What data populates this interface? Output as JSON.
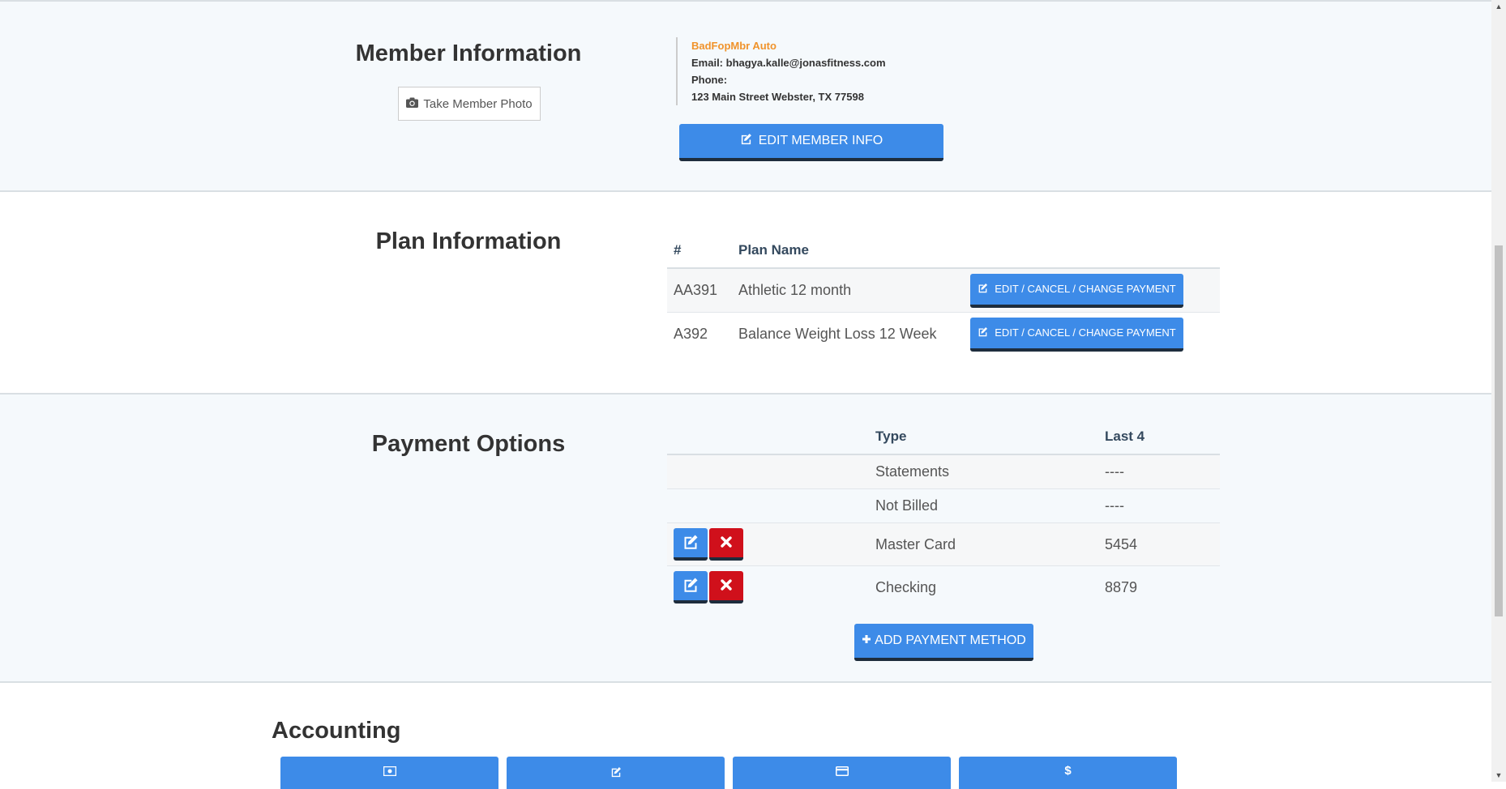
{
  "member": {
    "title": "Member Information",
    "photo_button": "Take Member Photo",
    "name": "BadFopMbr Auto",
    "email": "Email: bhagya.kalle@jonasfitness.com",
    "phone": "Phone:",
    "address": "123 Main Street Webster, TX 77598",
    "edit_button": "EDIT MEMBER INFO"
  },
  "plan": {
    "title": "Plan Information",
    "headers": [
      "#",
      "Plan Name"
    ],
    "rows": [
      {
        "id": "AA391",
        "name": "Athletic 12 month",
        "button": "EDIT / CANCEL / CHANGE PAYMENT"
      },
      {
        "id": "A392",
        "name": "Balance Weight Loss 12 Week",
        "button": "EDIT / CANCEL / CHANGE PAYMENT"
      }
    ]
  },
  "payment": {
    "title": "Payment Options",
    "headers": [
      "Type",
      "Last 4"
    ],
    "rows": [
      {
        "type": "Statements",
        "last4": "----"
      },
      {
        "type": "Not Billed",
        "last4": "----"
      },
      {
        "type": "Master Card",
        "last4": "5454"
      },
      {
        "type": "Checking",
        "last4": "8879"
      }
    ],
    "add_button": "ADD PAYMENT METHOD"
  },
  "accounting": {
    "title": "Accounting",
    "buttons": [
      "money-icon",
      "edit-icon",
      "credit-card-icon",
      "dollar-icon"
    ]
  },
  "colors": {
    "primary": "#3d8be8",
    "danger": "#d0101b",
    "member_name": "#f0932b"
  }
}
